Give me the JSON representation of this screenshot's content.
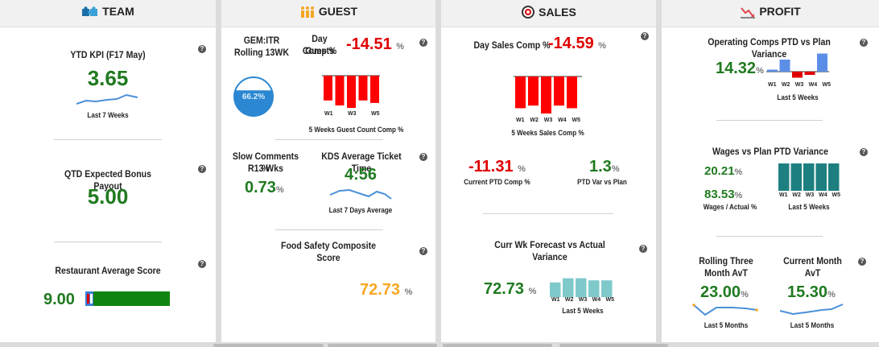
{
  "team": {
    "header": "TEAM",
    "ytd_kpi": {
      "label": "YTD KPI (F17 May)",
      "value": "3.65",
      "sub": "Last 7 Weeks"
    },
    "qtd_bonus": {
      "label": "QTD Expected Bonus Payout",
      "value": "5.00"
    },
    "restaurant_score": {
      "label": "Restaurant Average Score",
      "value": "9.00",
      "bar_fraction": 0.9
    }
  },
  "guest": {
    "header": "GUEST",
    "gem": {
      "label_line1": "GEM:ITR",
      "label_line2": "Rolling 13WK",
      "gauge_value": "66.2%",
      "gauge_fraction": 0.662
    },
    "day_guests": {
      "label_line1": "Day Guests",
      "label_line2": "Comp %",
      "value": "-14.51",
      "unit": "%",
      "ticks": [
        "W1",
        "W3",
        "W5"
      ],
      "chart_caption": "5 Weeks Guest Count Comp %",
      "bars": [
        -10,
        -12,
        -13,
        -10,
        -11
      ]
    },
    "slow_comments": {
      "label_line1": "Slow Comments %",
      "label_line2": "R13 Wks",
      "value": "0.73",
      "unit": "%"
    },
    "kds": {
      "label": "KDS Average Ticket Time",
      "value": "4:56",
      "sub": "Last 7 Days Average"
    },
    "food_safety": {
      "label": "Food Safety Composite Score",
      "value": "72.73",
      "unit": "%"
    }
  },
  "sales": {
    "header": "SALES",
    "day_sales": {
      "label": "Day Sales Comp %",
      "value": "-14.59",
      "unit": "%",
      "ticks": [
        "W1",
        "W2",
        "W3",
        "W4",
        "W5"
      ],
      "chart_caption": "5 Weeks Sales Comp %",
      "bars": [
        -12,
        -11,
        -14,
        -11,
        -12
      ]
    },
    "current_ptd": {
      "value": "-11.31",
      "unit": "%",
      "label": "Current PTD Comp %"
    },
    "ptd_var": {
      "value": "1.3",
      "unit": "%",
      "label": "PTD Var vs Plan"
    },
    "forecast": {
      "label": "Curr Wk Forecast vs Actual Variance",
      "value": "72.73",
      "unit": "%",
      "ticks": [
        "W1",
        "W2",
        "W3",
        "W4",
        "W5"
      ],
      "chart_caption": "Last 5 Weeks",
      "bars": [
        7,
        9,
        9,
        8,
        8
      ]
    }
  },
  "profit": {
    "header": "PROFIT",
    "operating": {
      "label": "Operating Comps PTD vs Plan Variance",
      "value": "14.32",
      "unit": "%",
      "ticks": [
        "W1",
        "W2",
        "W3",
        "W4",
        "W5"
      ],
      "chart_caption": "Last 5 Weeks",
      "bars": [
        0.5,
        3,
        -1.5,
        -0.8,
        4.5
      ]
    },
    "wages": {
      "label": "Wages vs Plan PTD Variance",
      "value": "20.21",
      "unit": "%",
      "value2": "83.53",
      "unit2": "%",
      "sub": "Wages / Actual %",
      "ticks": [
        "W1",
        "W2",
        "W3",
        "W4",
        "W5"
      ],
      "chart_caption": "Last 5 Weeks",
      "bars": [
        10,
        10,
        10,
        10,
        10
      ]
    },
    "rolling": {
      "label_line1": "Rolling Three",
      "label_line2": "Month AvT",
      "value": "23.00",
      "unit": "%",
      "sub": "Last 5 Months"
    },
    "current_month": {
      "label_line1": "Current Month",
      "label_line2": "AvT",
      "value": "15.30",
      "unit": "%",
      "sub": "Last 5 Months"
    }
  },
  "help_glyph": "?",
  "colors": {
    "green": "#1f7a1f",
    "red": "#e00000",
    "orange": "#f5a623",
    "bar_teal": "#1e7f80",
    "bar_light_teal": "#7fc9cb",
    "bar_blue": "#5b8ee6",
    "spark_blue": "#4a90d9"
  }
}
